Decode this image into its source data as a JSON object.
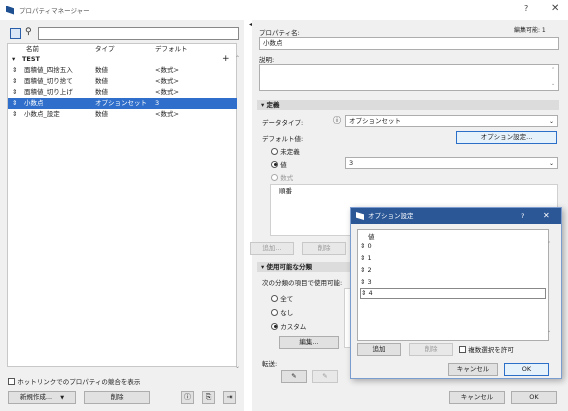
{
  "window": {
    "title": "プロパティマネージャー",
    "help": "?",
    "close": "✕"
  },
  "left": {
    "columns": [
      "名前",
      "タイプ",
      "デフォルト"
    ],
    "group": "TEST",
    "rows": [
      {
        "name": "面積値_四捨五入",
        "type": "数値",
        "default": "<数式>"
      },
      {
        "name": "面積値_切り捨て",
        "type": "数値",
        "default": "<数式>"
      },
      {
        "name": "面積値_切り上げ",
        "type": "数値",
        "default": "<数式>"
      },
      {
        "name": "小数点",
        "type": "オプションセット",
        "default": "3"
      },
      {
        "name": "小数点_設定",
        "type": "数値",
        "default": "<数式>"
      }
    ],
    "hotlink_label": "ホットリンクでのプロパティの競合を表示",
    "new_button": "新規作成...",
    "delete_button": "削除"
  },
  "right": {
    "property_name_label": "プロパティ名:",
    "edit_status": "編集可能: 1",
    "property_name_value": "小数点",
    "description_label": "説明:",
    "definition_section": "定義",
    "datatype_label": "データタイプ:",
    "datatype_value": "オプションセット",
    "default_label": "デフォルト値:",
    "option_settings_button": "オプション設定...",
    "undefined_label": "未定義",
    "value_label": "値",
    "value_value": "3",
    "formula_label": "数式",
    "order_label": "順番",
    "add_button": "追加...",
    "delete_button": "削除",
    "available_section": "使用可能な分類",
    "available_desc": "次の分類の項目で使用可能:",
    "all_label": "全て",
    "none_label": "なし",
    "custom_label": "カスタム",
    "edit_button": "編集...",
    "transfer_label": "転送:",
    "cancel_button": "キャンセル",
    "ok_button": "OK"
  },
  "dialog": {
    "title": "オプション設定",
    "help": "?",
    "close": "✕",
    "column": "値",
    "items": [
      "0",
      "1",
      "2",
      "3",
      "4"
    ],
    "add_button": "追加",
    "delete_button": "削除",
    "multi_select_label": "複数選択を許可",
    "cancel_button": "キャンセル",
    "ok_button": "OK"
  }
}
